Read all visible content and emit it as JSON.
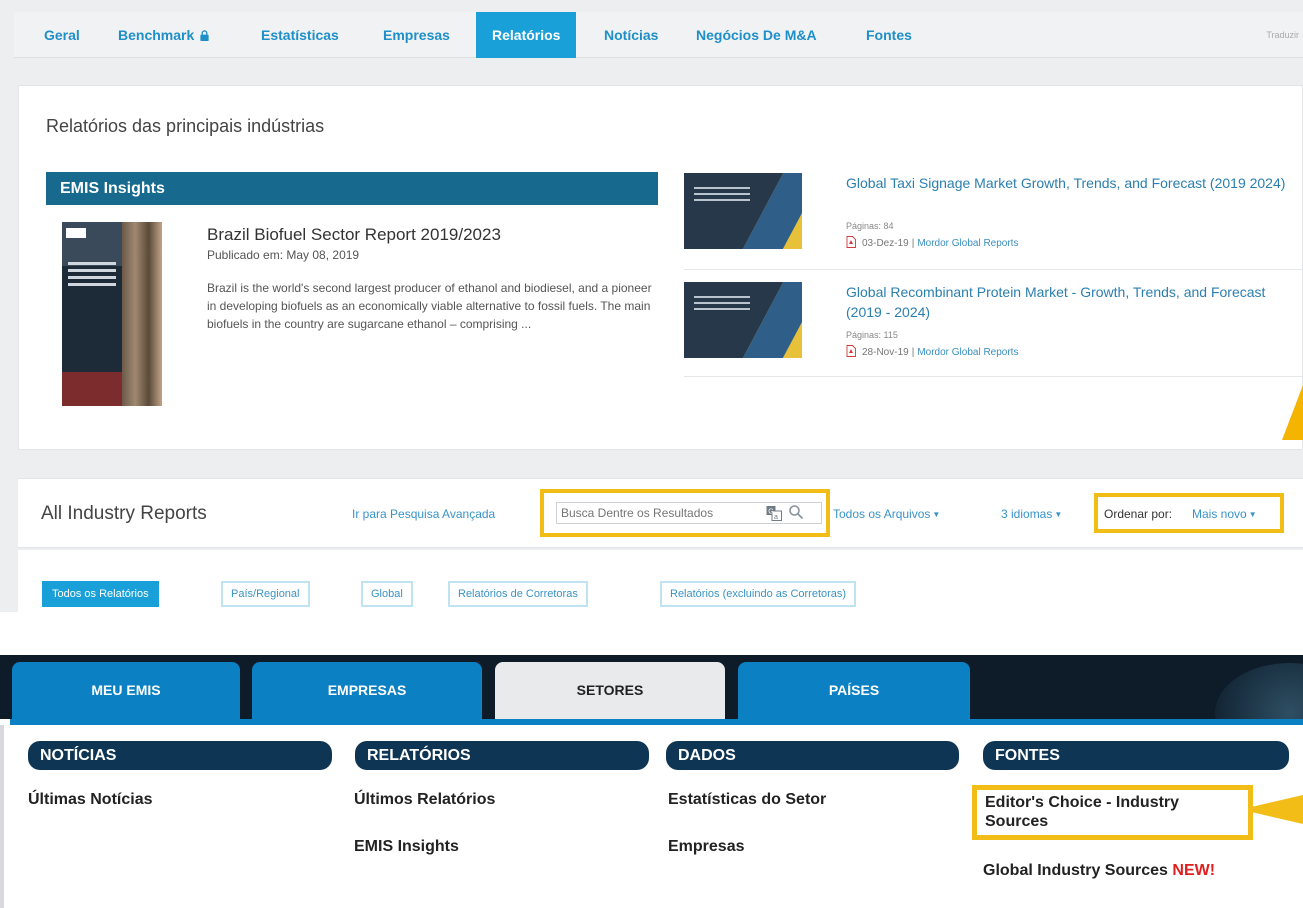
{
  "top_nav": {
    "tabs": [
      {
        "label": "Geral"
      },
      {
        "label": "Benchmark"
      },
      {
        "label": "Estatísticas"
      },
      {
        "label": "Empresas"
      },
      {
        "label": "Relatórios"
      },
      {
        "label": "Notícias"
      },
      {
        "label": "Negócios De M&A"
      },
      {
        "label": "Fontes"
      }
    ],
    "active_tab": "Relatórios",
    "translate_label": "Traduzir",
    "lock_icon": "lock-icon"
  },
  "featured": {
    "title": "Relatórios das principais indústrias",
    "insights_label": "EMIS Insights",
    "report": {
      "title": "Brazil Biofuel Sector Report 2019/2023",
      "published": "Publicado em: May 08, 2019",
      "description": "Brazil is the world's second largest producer of ethanol and biodiesel, and a pioneer in developing biofuels as an economically viable alternative to fossil fuels. The main biofuels in the country are sugarcane ethanol – comprising ..."
    },
    "side_reports": [
      {
        "title": "Global Taxi Signage Market Growth, Trends, and Forecast (2019 2024)",
        "pages": "Páginas: 84",
        "date": "03-Dez-19",
        "source": "Mordor Global Reports"
      },
      {
        "title": "Global Recombinant Protein Market - Growth, Trends, and Forecast (2019 - 2024)",
        "pages": "Páginas: 115",
        "date": "28-Nov-19",
        "source": "Mordor Global Reports"
      }
    ]
  },
  "all_reports": {
    "title": "All Industry Reports",
    "advanced_search": "Ir para Pesquisa Avançada",
    "search_placeholder": "Busca Dentre os Resultados",
    "files_filter": "Todos os Arquivos",
    "languages_filter": "3 idiomas",
    "sort_label": "Ordenar por:",
    "sort_value": "Mais novo",
    "chips": [
      "Todos os Relatórios",
      "País/Regional",
      "Global",
      "Relatórios de Corretoras",
      "Relatórios (excluindo as Corretoras)"
    ],
    "active_chip": "Todos os Relatórios"
  },
  "main_nav": {
    "tabs": [
      "MEU EMIS",
      "EMPRESAS",
      "SETORES",
      "PAÍSES"
    ],
    "active_tab": "SETORES",
    "sections": [
      {
        "header": "NOTÍCIAS",
        "links": [
          "Últimas Notícias"
        ]
      },
      {
        "header": "RELATÓRIOS",
        "links": [
          "Últimos Relatórios",
          "EMIS Insights"
        ]
      },
      {
        "header": "DADOS",
        "links": [
          "Estatísticas do Setor",
          "Empresas"
        ]
      },
      {
        "header": "FONTES",
        "links": [
          "Editor's Choice - Industry Sources",
          "Global Industry Sources"
        ]
      }
    ],
    "new_badge": "NEW!"
  },
  "colors": {
    "accent_blue": "#1aa0d8",
    "link_blue": "#3a93c6",
    "insights_bar": "#176a8e",
    "highlight_yellow": "#f2bd16",
    "nav_dark": "#0e1c2a",
    "pill_navy": "#0e3554",
    "new_red": "#e0201f"
  }
}
